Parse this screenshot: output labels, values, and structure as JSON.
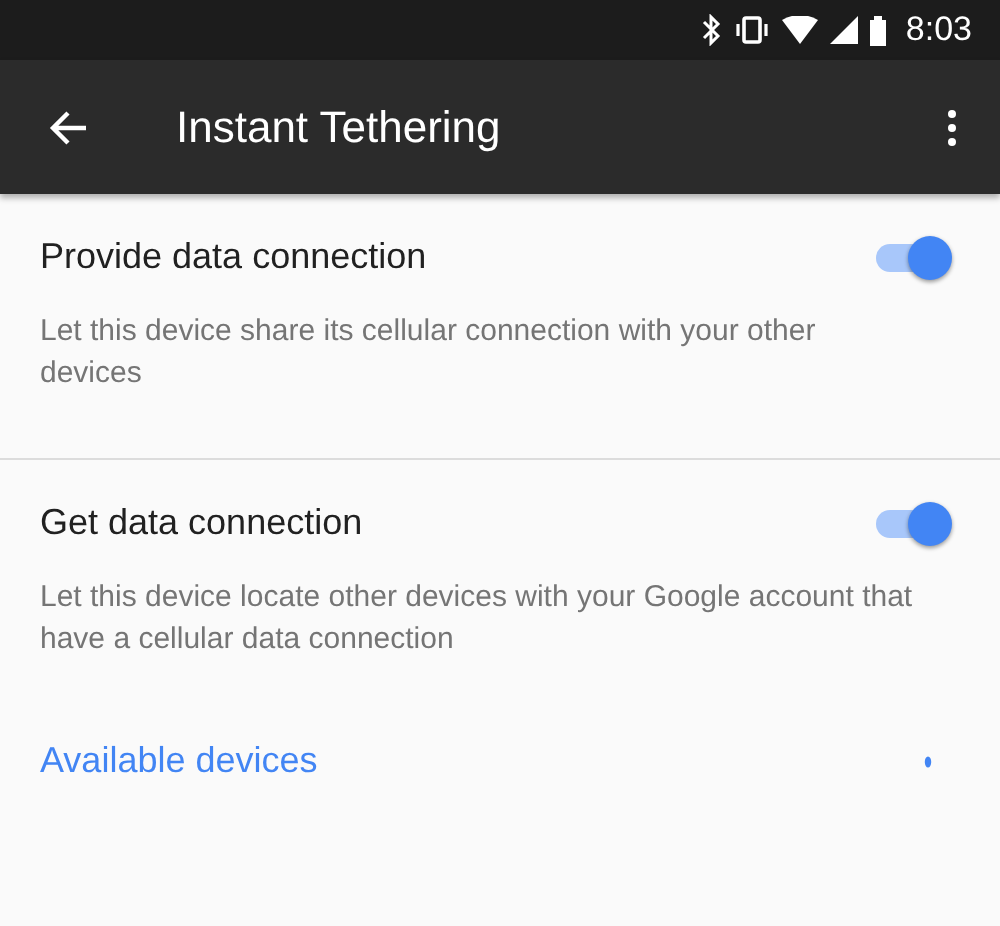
{
  "status_bar": {
    "time": "8:03"
  },
  "app_bar": {
    "title": "Instant Tethering"
  },
  "settings": [
    {
      "title": "Provide data connection",
      "description": "Let this device share its cellular connection with your other devices",
      "on": true
    },
    {
      "title": "Get data connection",
      "description": "Let this device locate other devices with your Google account that have a cellular data connection",
      "on": true
    }
  ],
  "link": {
    "label": "Available devices"
  }
}
